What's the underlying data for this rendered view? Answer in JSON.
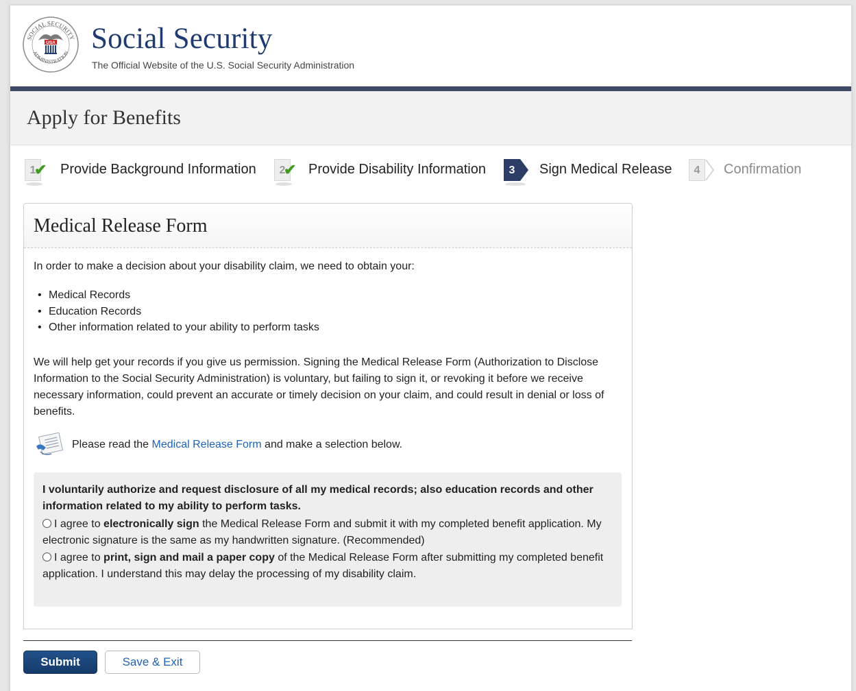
{
  "header": {
    "seal_text_top": "SOCIAL SECURITY",
    "seal_text_bottom": "ADMINISTRATION",
    "seal_badge": "USA",
    "title": "Social Security",
    "subtitle": "The Official Website of the U.S. Social Security Administration"
  },
  "page_title": "Apply for Benefits",
  "steps": [
    {
      "number": "1",
      "label": "Provide Background Information",
      "status": "complete"
    },
    {
      "number": "2",
      "label": "Provide Disability Information",
      "status": "complete"
    },
    {
      "number": "3",
      "label": "Sign Medical Release",
      "status": "current"
    },
    {
      "number": "4",
      "label": "Confirmation",
      "status": "upcoming"
    }
  ],
  "form": {
    "title": "Medical Release Form",
    "intro": "In order to make a decision about your disability claim, we need to obtain your:",
    "bullets": [
      "Medical Records",
      "Education Records",
      "Other information related to your ability to perform tasks"
    ],
    "permission_text": "We will help get your records if you give us permission. Signing the Medical Release Form (Authorization to Disclose Information to the Social Security Administration) is voluntary, but failing to sign it, or revoking it before we receive necessary information, could prevent an accurate or timely decision on your claim, and could result in denial or loss of benefits.",
    "read_prefix": "Please read the ",
    "read_link": "Medical Release Form",
    "read_suffix": " and make a selection below.",
    "consent_heading": "I voluntarily authorize and request disclosure of all my medical records; also education records and other information related to my ability to perform tasks.",
    "option1": {
      "pre": "I agree to ",
      "bold": "electronically sign",
      "post": " the Medical Release Form and submit it with my completed benefit application. My electronic signature is the same as my handwritten signature. (Recommended)",
      "selected": false
    },
    "option2": {
      "pre": "I agree to ",
      "bold": "print, sign and mail a paper copy",
      "post": " of the Medical Release Form after submitting my completed benefit application. I understand this may delay the processing of my disability claim.",
      "selected": false
    }
  },
  "buttons": {
    "submit": "Submit",
    "save_exit": "Save & Exit"
  },
  "colors": {
    "brand_navy": "#1e3a6e",
    "header_bar": "#3e4a66",
    "step_active": "#2c3e66",
    "check_green": "#3f9b1b",
    "link_blue": "#1d63b5"
  }
}
